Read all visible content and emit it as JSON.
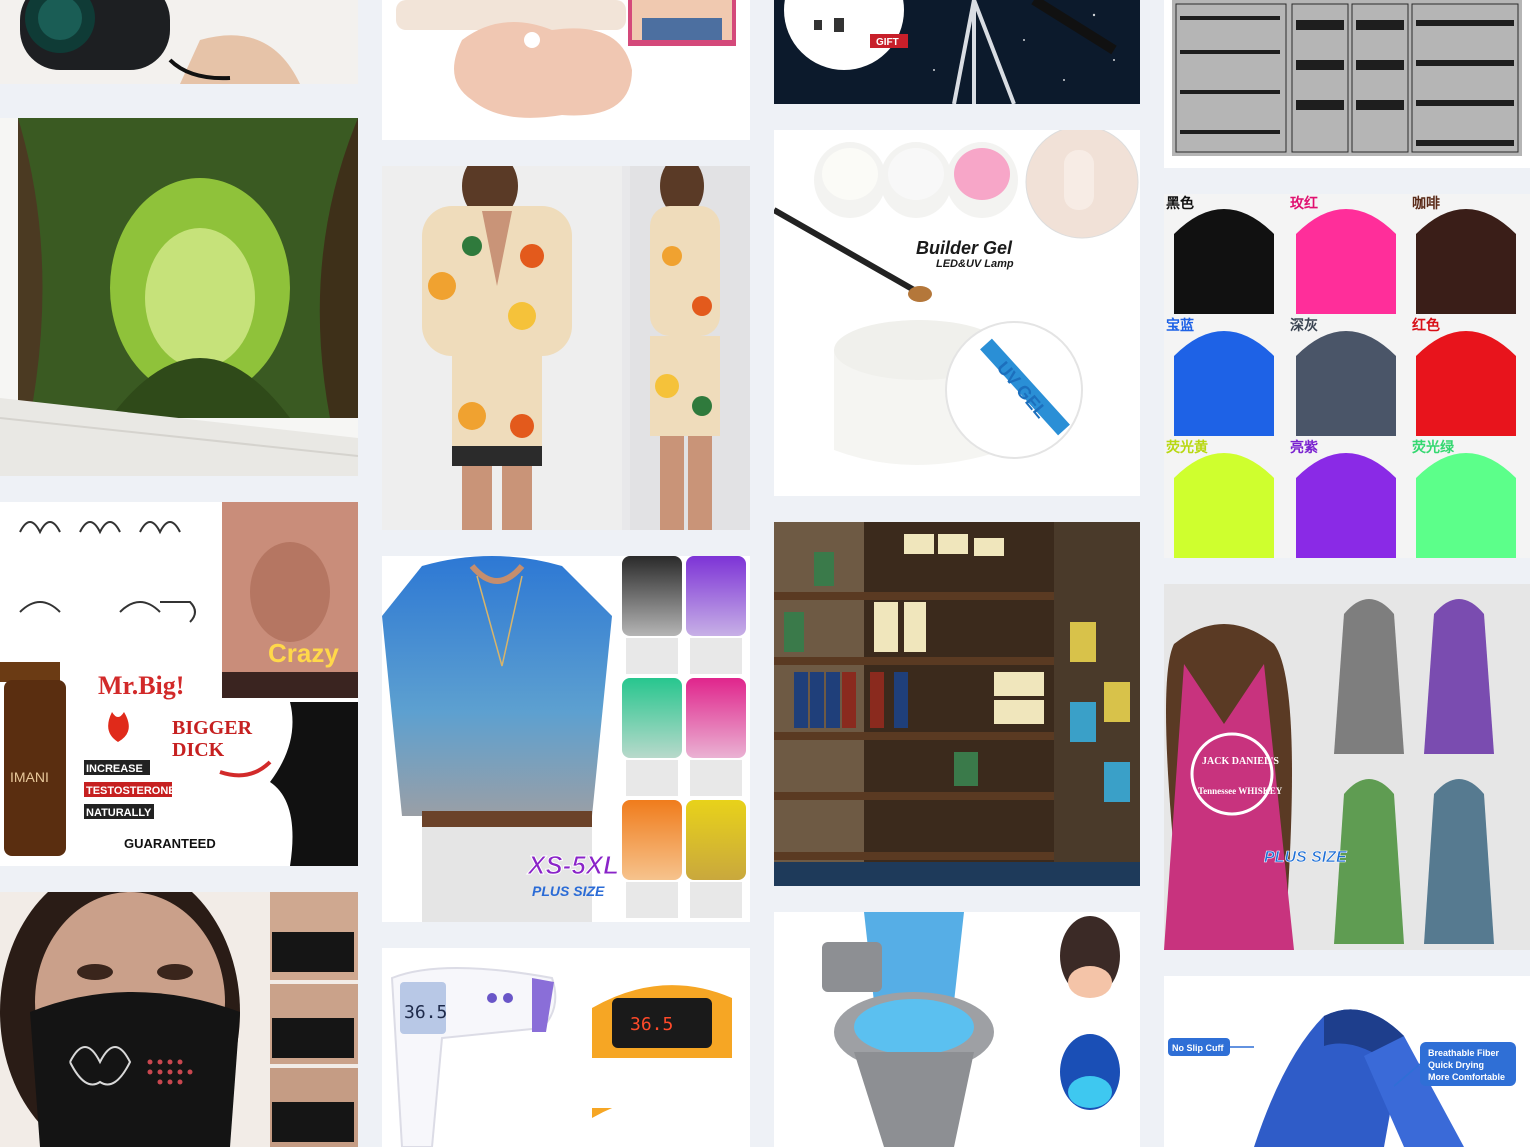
{
  "products": {
    "gel": {
      "brand_line1": "Builder Gel",
      "brand_line2": "LED&UV Lamp",
      "jar_label": "UV GEL"
    },
    "supplement": {
      "bubble_top": "Crazy",
      "title": "Mr.Big!",
      "line1": "BIGGER",
      "line2": "DICK",
      "tag1": "INCREASE",
      "tag2": "TESTOSTERONE",
      "tag3": "NATURALLY",
      "footer": "GUARANTEED",
      "bottle_brand": "IMANI"
    },
    "top_size": {
      "size": "XS-5XL",
      "note": "PLUS SIZE"
    },
    "telescope": {
      "badge": "GIFT"
    },
    "beanies": {
      "labels": [
        "黑色",
        "玫红",
        "咖啡",
        "宝蓝",
        "深灰",
        "红色",
        "荧光黄",
        "亮紫",
        "荧光绿"
      ]
    },
    "tank_dress": {
      "badge": "PLUS SIZE",
      "print1": "JACK DANIEL'S",
      "print2": "Tennessee WHISKEY"
    },
    "thermometer": {
      "reading1": "36.5",
      "reading2": "36.5"
    },
    "socks": {
      "callout1": "No Slip Cuff",
      "callout2_l1": "Breathable Fiber",
      "callout2_l2": "Quick Drying",
      "callout2_l3": "More Comfortable"
    }
  }
}
